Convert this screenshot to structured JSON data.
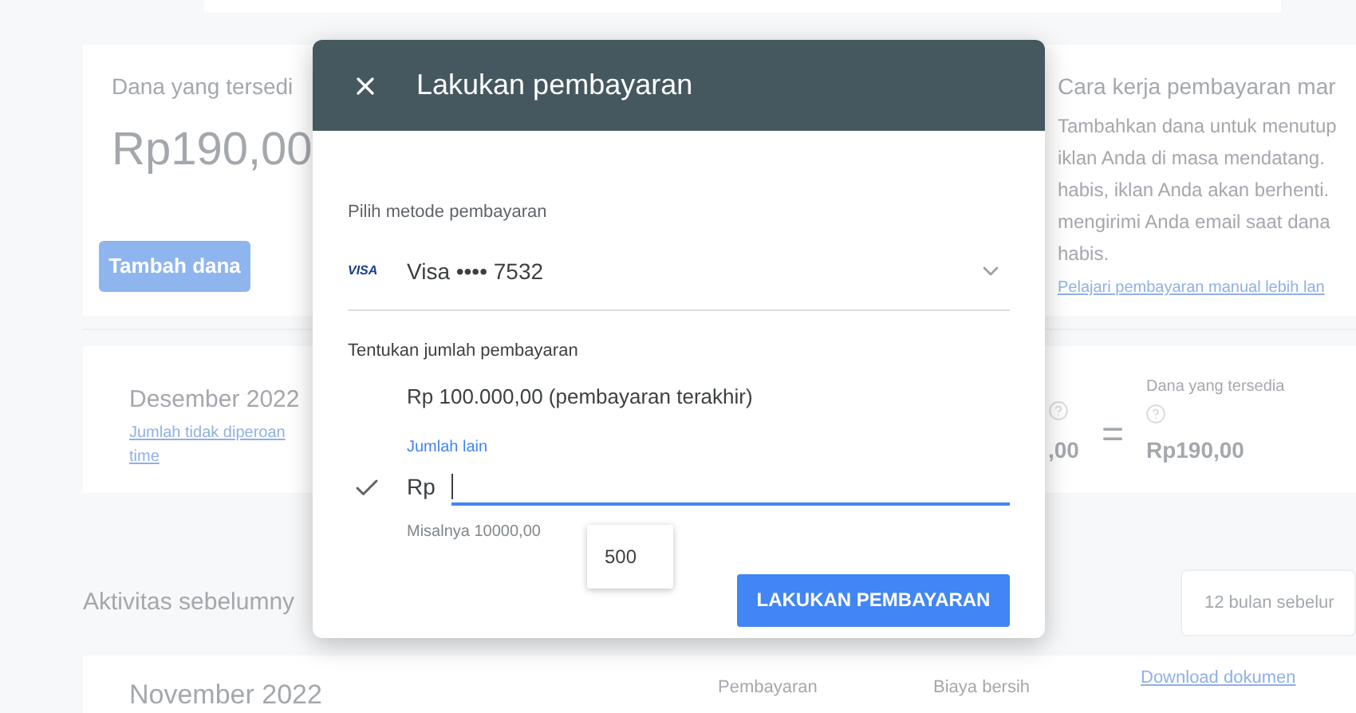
{
  "background": {
    "funds_card": {
      "label": "Dana yang tersedi",
      "amount": "Rp190,00",
      "button": "Tambah dana"
    },
    "info": {
      "title": "Cara kerja pembayaran mar",
      "body": "Tambahkan dana untuk menutup iklan Anda di masa mendatang. habis, iklan Anda akan berhenti. mengirimi Anda email saat dana habis.",
      "link": "Pelajari pembayaran manual lebih lan"
    },
    "month_row": {
      "month": "Desember 2022",
      "link": "Jumlah tidak diperoan",
      "link_2": "time",
      "partial_amount": ",00",
      "equals": "=",
      "result_label": "Dana yang tersedia",
      "result_amount": "Rp190,00"
    },
    "activity": {
      "title": "Aktivitas sebelumny",
      "range": "12 bulan sebelur"
    },
    "bottom_row": {
      "month": "November 2022",
      "column_1": "Pembayaran",
      "column_2": "Biaya bersih",
      "link": "Download dokumen"
    }
  },
  "dialog": {
    "title": "Lakukan pembayaran",
    "method_label": "Pilih metode pembayaran",
    "card_brand": "VISA",
    "card": "Visa •••• 7532",
    "amount_label": "Tentukan jumlah pembayaran",
    "options": [
      {
        "kind": "preset",
        "label": "Rp 100.000,00 (pembayaran terakhir)",
        "selected": false
      },
      {
        "kind": "custom",
        "label": "Jumlah lain",
        "prefix": "Rp",
        "hint": "Misalnya 10000,00",
        "selected": true
      }
    ],
    "suggestion": "500",
    "submit": "LAKUKAN PEMBAYARAN"
  }
}
